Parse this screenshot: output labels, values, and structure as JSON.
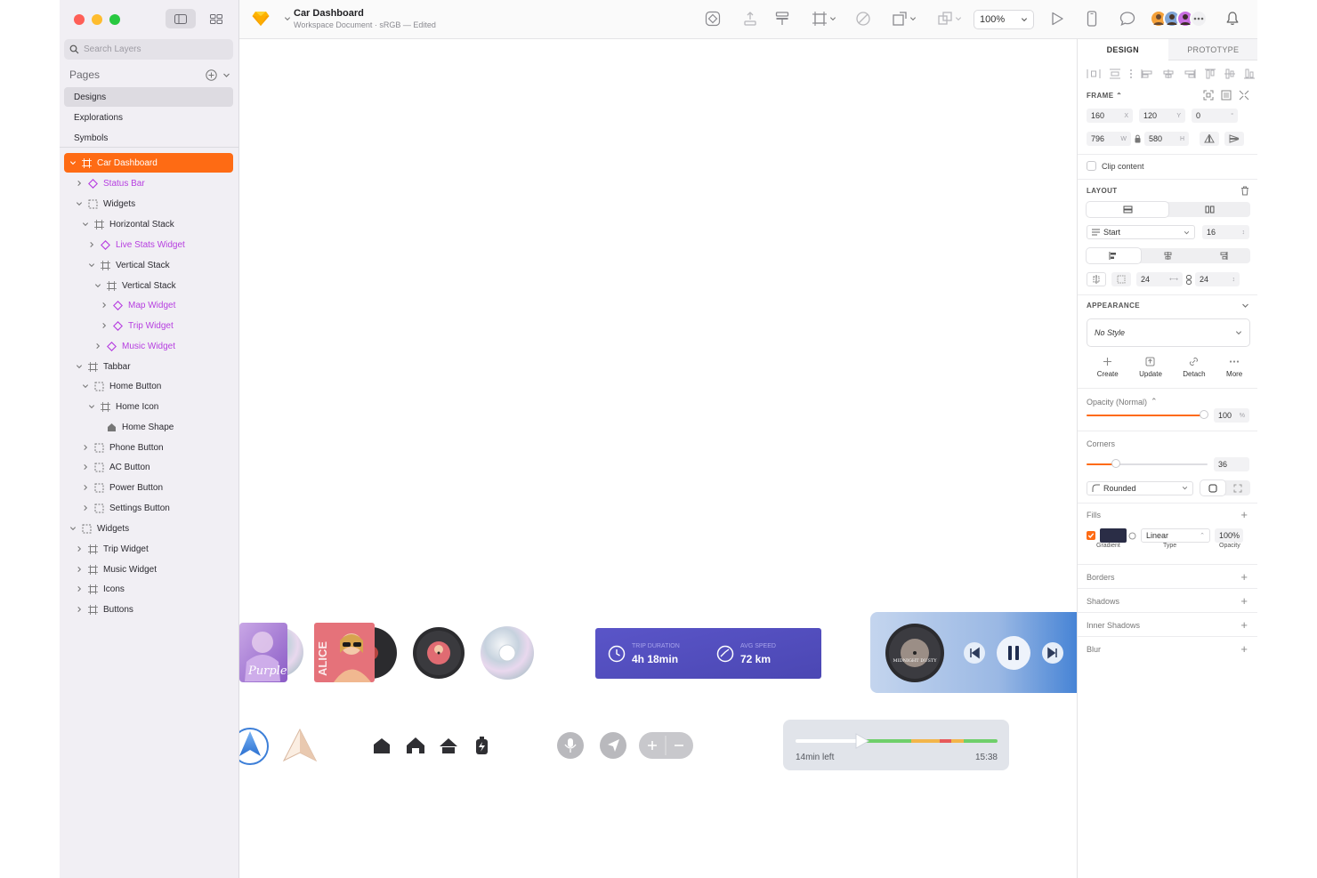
{
  "app": {
    "doc_title": "Car Dashboard",
    "doc_subtitle": "Workspace Document · sRGB — Edited",
    "zoom": "100%"
  },
  "sidebar": {
    "search_placeholder": "Search Layers",
    "pages_label": "Pages",
    "pages": [
      "Designs",
      "Explorations",
      "Symbols"
    ],
    "layers": [
      {
        "label": "Car Dashboard",
        "icon": "frame-icon"
      },
      {
        "label": "Status Bar",
        "icon": "symbol-icon"
      },
      {
        "label": "Widgets",
        "icon": "group-icon"
      },
      {
        "label": "Horizontal Stack",
        "icon": "frame-icon"
      },
      {
        "label": "Live Stats Widget",
        "icon": "symbol-icon"
      },
      {
        "label": "Vertical Stack",
        "icon": "frame-icon"
      },
      {
        "label": "Vertical Stack",
        "icon": "frame-icon"
      },
      {
        "label": "Map Widget",
        "icon": "symbol-icon"
      },
      {
        "label": "Trip Widget",
        "icon": "symbol-icon"
      },
      {
        "label": "Music Widget",
        "icon": "symbol-icon"
      },
      {
        "label": "Tabbar",
        "icon": "frame-icon"
      },
      {
        "label": "Home Button",
        "icon": "group-icon"
      },
      {
        "label": "Home Icon",
        "icon": "frame-icon"
      },
      {
        "label": "Home Shape",
        "icon": "home-icon"
      },
      {
        "label": "Phone Button",
        "icon": "group-icon"
      },
      {
        "label": "AC Button",
        "icon": "group-icon"
      },
      {
        "label": "Power Button",
        "icon": "group-icon"
      },
      {
        "label": "Settings Button",
        "icon": "group-icon"
      },
      {
        "label": "Widgets",
        "icon": "group-icon"
      },
      {
        "label": "Trip Widget",
        "icon": "frame-icon"
      },
      {
        "label": "Music Widget",
        "icon": "frame-icon"
      },
      {
        "label": "Icons",
        "icon": "frame-icon"
      },
      {
        "label": "Buttons",
        "icon": "frame-icon"
      }
    ]
  },
  "canvas": {
    "trip_duration_label": "TRIP DURATION",
    "trip_duration_value": "4h 18min",
    "avg_speed_label": "AVG SPEED",
    "avg_speed_value": "72 km",
    "album_text_1": "Purple",
    "album_text_2": "ALICE",
    "record_label": "MIDNIGHT DUSTY",
    "progress_left": "14min left",
    "progress_time": "15:38",
    "player_progress": 0.3
  },
  "inspector": {
    "tab_design": "DESIGN",
    "tab_prototype": "PROTOTYPE",
    "frame_label": "FRAME",
    "x": "160",
    "x_suffix": "X",
    "y": "120",
    "y_suffix": "Y",
    "rotation": "0",
    "rotation_suffix": "°",
    "w": "796",
    "w_suffix": "W",
    "h": "580",
    "h_suffix": "H",
    "clip_content": "Clip content",
    "layout_label": "LAYOUT",
    "align_value": "Start",
    "spacing_value": "16",
    "padding_h": "24",
    "padding_v": "24",
    "appearance_label": "APPEARANCE",
    "style_value": "No Style",
    "style_actions": [
      "Create",
      "Update",
      "Detach",
      "More"
    ],
    "opacity_label": "Opacity (Normal)",
    "opacity_value": "100",
    "opacity_unit": "%",
    "opacity_fraction": 1.0,
    "corners_label": "Corners",
    "corners_value": "36",
    "corners_fraction": 0.24,
    "corner_style": "Rounded",
    "fills_label": "Fills",
    "fill_type": "Linear",
    "fill_opacity": "100%",
    "fill_caption_gradient": "Gradient",
    "fill_caption_type": "Type",
    "fill_caption_opacity": "Opacity",
    "fill_color": "#2a2d46",
    "sections": [
      "Borders",
      "Shadows",
      "Inner Shadows",
      "Blur"
    ]
  },
  "colors": {
    "accent": "#fe6b14",
    "symbol": "#b63ee0",
    "trip_widget": "#5b54c4",
    "music_widget": "#a9c3e6"
  }
}
